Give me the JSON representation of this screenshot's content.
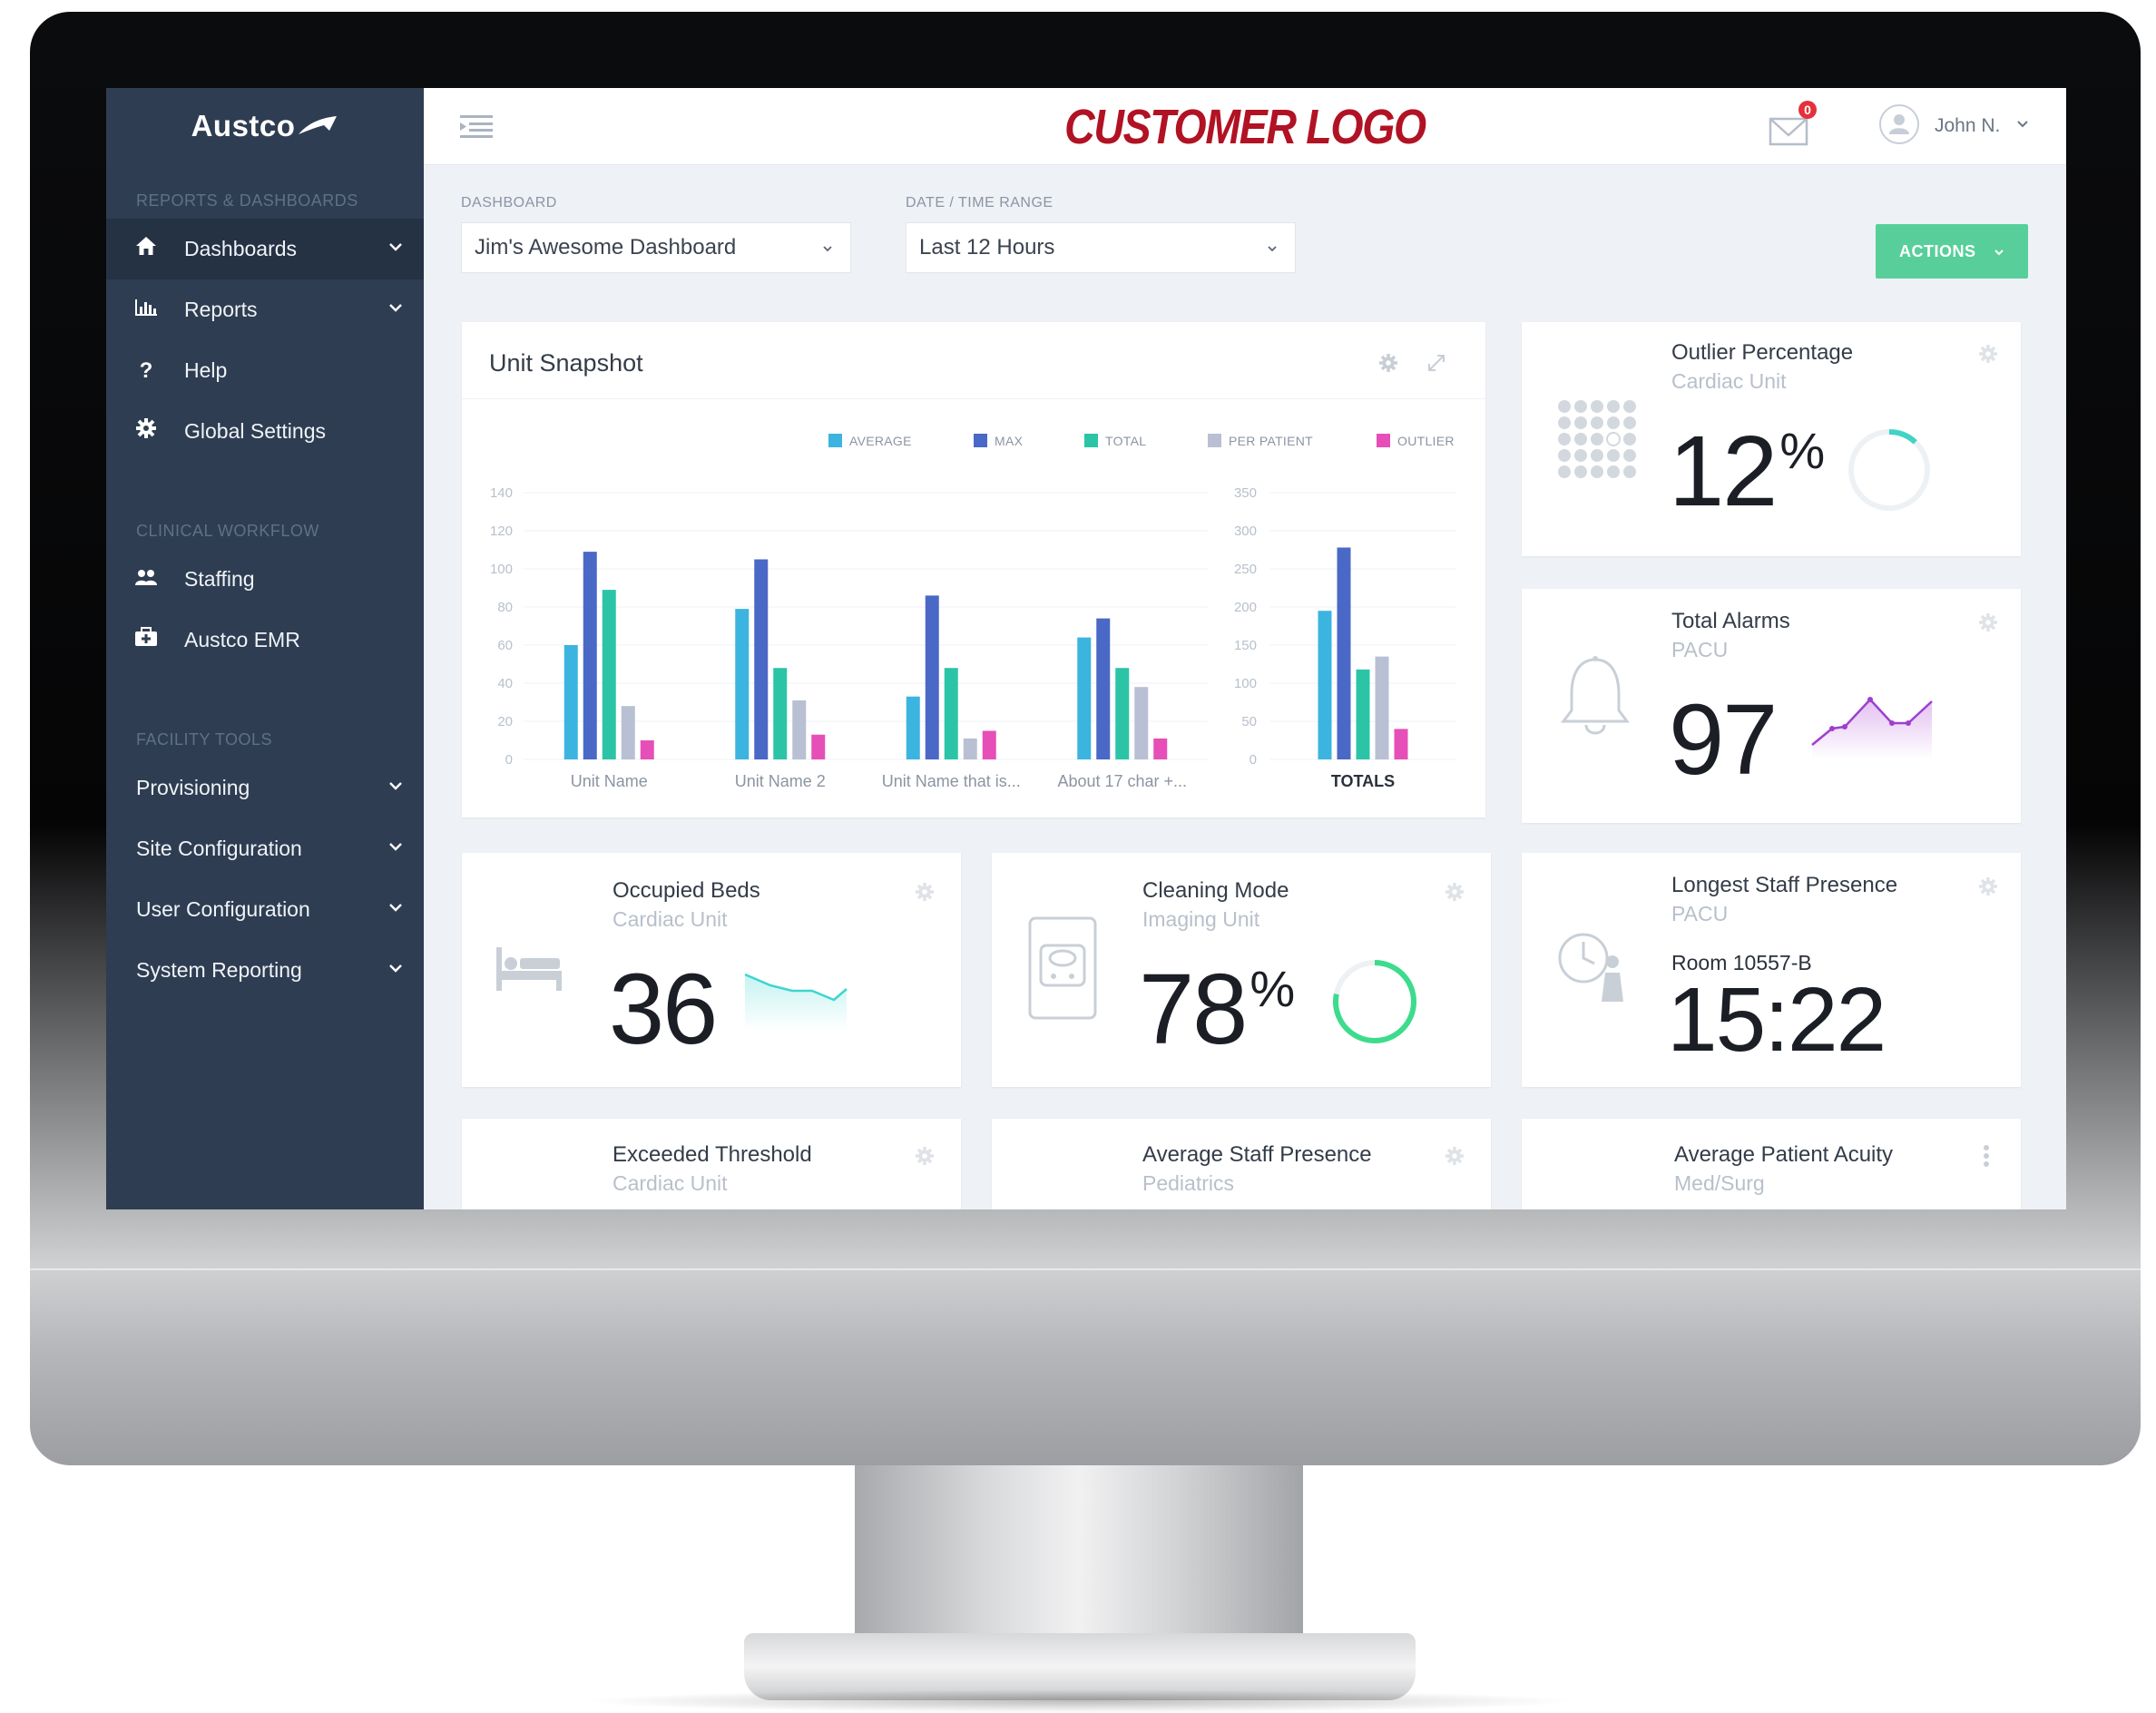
{
  "brand": {
    "name": "Austco"
  },
  "customer_logo": "CUSTOMER LOGO",
  "sidebar": {
    "sections": [
      {
        "title": "REPORTS & DASHBOARDS",
        "items": [
          {
            "label": "Dashboards",
            "icon": "home-icon",
            "chevron": true,
            "active": true
          },
          {
            "label": "Reports",
            "icon": "bar-chart-icon",
            "chevron": true
          },
          {
            "label": "Help",
            "icon": "question-icon",
            "chevron": false
          },
          {
            "label": "Global Settings",
            "icon": "gear-icon",
            "chevron": false
          }
        ]
      },
      {
        "title": "CLINICAL WORKFLOW",
        "items": [
          {
            "label": "Staffing",
            "icon": "users-icon",
            "chevron": false
          },
          {
            "label": "Austco EMR",
            "icon": "medical-case-icon",
            "chevron": false
          }
        ]
      },
      {
        "title": "FACILITY TOOLS",
        "items": [
          {
            "label": "Provisioning",
            "chevron": true
          },
          {
            "label": "Site Configuration",
            "chevron": true
          },
          {
            "label": "User Configuration",
            "chevron": true
          },
          {
            "label": "System Reporting",
            "chevron": true
          }
        ]
      }
    ]
  },
  "header": {
    "mail_badge": "0",
    "user_name": "John N."
  },
  "filters": {
    "dashboard_label": "DASHBOARD",
    "dashboard_value": "Jim's Awesome Dashboard",
    "range_label": "DATE / TIME RANGE",
    "range_value": "Last 12 Hours",
    "actions_label": "ACTIONS"
  },
  "unit_snapshot": {
    "title": "Unit Snapshot"
  },
  "chart_data": {
    "type": "bar",
    "title": "Unit Snapshot",
    "legend_position": "top-right",
    "series_names": [
      "AVERAGE",
      "MAX",
      "TOTAL",
      "PER PATIENT",
      "OUTLIER"
    ],
    "colors": [
      "#3cb4e0",
      "#4a68c6",
      "#2cc4a6",
      "#b9c0d3",
      "#e64fb7"
    ],
    "groups": [
      {
        "ylim": [
          0,
          140
        ],
        "yticks": [
          0,
          20,
          40,
          60,
          80,
          100,
          120,
          140
        ],
        "categories": [
          "Unit Name",
          "Unit Name 2",
          "Unit Name that is...",
          "About 17 char +..."
        ],
        "values": [
          [
            60,
            109,
            89,
            28,
            10
          ],
          [
            79,
            105,
            48,
            31,
            13
          ],
          [
            33,
            86,
            48,
            11,
            15
          ],
          [
            64,
            74,
            48,
            38,
            11
          ]
        ]
      },
      {
        "ylim": [
          0,
          350
        ],
        "yticks": [
          0,
          50,
          100,
          150,
          200,
          250,
          300,
          350
        ],
        "categories": [
          "TOTALS"
        ],
        "values": [
          [
            195,
            278,
            118,
            135,
            40
          ]
        ]
      }
    ],
    "grid": true
  },
  "cards": {
    "outlier": {
      "title": "Outlier Percentage",
      "sub": "Cardiac Unit",
      "value": "12",
      "unit": "%",
      "fraction": 0.12
    },
    "alarms": {
      "title": "Total Alarms",
      "sub": "PACU",
      "value": "97"
    },
    "beds": {
      "title": "Occupied Beds",
      "sub": "Cardiac Unit",
      "value": "36"
    },
    "cleaning": {
      "title": "Cleaning Mode",
      "sub": "Imaging Unit",
      "value": "78",
      "unit": "%",
      "fraction": 0.78
    },
    "longest": {
      "title": "Longest Staff Presence",
      "sub": "PACU",
      "room": "Room 10557-B",
      "value": "15:22"
    },
    "exceeded": {
      "title": "Exceeded Threshold",
      "sub": "Cardiac Unit"
    },
    "avg_staff": {
      "title": "Average Staff Presence",
      "sub": "Pediatrics"
    },
    "acuity": {
      "title": "Average Patient Acuity",
      "sub": "Med/Surg"
    }
  }
}
